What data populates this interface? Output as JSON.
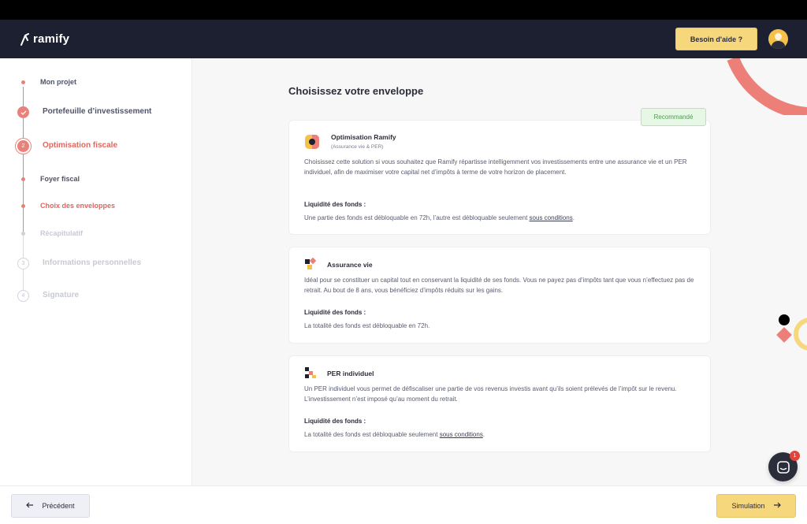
{
  "header": {
    "logo_text": "ramify",
    "help_label": "Besoin d'aide ?"
  },
  "sidebar": {
    "steps": [
      {
        "label": "Mon projet",
        "status": "done"
      },
      {
        "label": "Portefeuille d’investissement",
        "status": "done"
      },
      {
        "label": "Optimisation fiscale",
        "number": "2",
        "status": "active"
      },
      {
        "label": "Foyer fiscal",
        "status": "done"
      },
      {
        "label": "Choix des enveloppes",
        "status": "current"
      },
      {
        "label": "Récapitulatif",
        "status": "todo"
      },
      {
        "label": "Informations personnelles",
        "number": "3",
        "status": "todo"
      },
      {
        "label": "Signature",
        "number": "4",
        "status": "todo"
      }
    ]
  },
  "main": {
    "title": "Choisissez votre enveloppe",
    "recommended_label": "Recommandé",
    "cards": [
      {
        "title": "Optimisation Ramify",
        "subtitle": "(Assurance vie & PER)",
        "description": "Choisissez cette solution si vous souhaitez que Ramify répartisse intelligemment vos investissements entre une assurance vie et un PER individuel, afin de maximiser votre capital net d’impôts à terme de votre horizon de placement.",
        "liquidity_title": "Liquidité des fonds :",
        "liquidity_text": "Une partie des fonds est débloquable en 72h, l’autre est débloquable seulement ",
        "liquidity_link": "sous conditions",
        "liquidity_end": "."
      },
      {
        "title": "Assurance vie",
        "description": "Idéal pour se constituer un capital tout en conservant la liquidité de ses fonds. Vous ne payez pas d’impôts tant que vous n’effectuez pas de retrait. Au bout de 8 ans, vous bénéficiez d’impôts réduits sur les gains.",
        "liquidity_title": "Liquidité des fonds :",
        "liquidity_text": "La totalité des fonds est débloquable en 72h."
      },
      {
        "title": "PER individuel",
        "description": "Un PER individuel vous permet de défiscaliser une partie de vos revenus investis avant qu’ils soient prélevés de l’impôt sur le revenu. L’investissement n’est imposé qu’au moment du retrait.",
        "liquidity_title": "Liquidité des fonds :",
        "liquidity_text": "La totalité des fonds est débloquable seulement ",
        "liquidity_link": "sous conditions",
        "liquidity_end": "."
      }
    ]
  },
  "footer": {
    "prev_label": "Précédent",
    "next_label": "Simulation"
  },
  "chat": {
    "badge_count": "1"
  },
  "colors": {
    "accent": "#e98079",
    "yellow": "#f6d77c",
    "header": "#1d2030"
  }
}
